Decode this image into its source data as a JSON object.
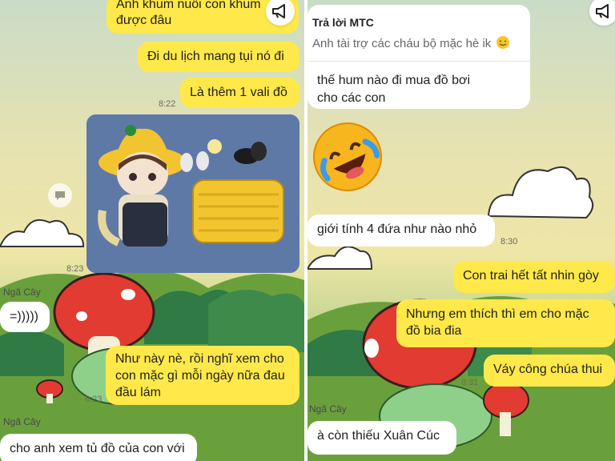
{
  "left": {
    "messages": {
      "m1": "Anh khum nuôi con khum",
      "m1b": "được đâu",
      "m2": "Đi du lịch mang tụi nó đi",
      "m3": "Là thêm 1 vali đồ",
      "m4a": "Như này nè, rồi nghĩ xem cho",
      "m4b": "con mặc gì mỗi ngày nữa đau",
      "m4c": "đầu lám",
      "t1": "=)))))",
      "t2": "cho anh xem tủ đồ của con với"
    },
    "times": {
      "a": "8:22",
      "b": "8:23",
      "c": "8:23"
    },
    "sender": "Ngã Cây",
    "sender2": "Ngã Cây"
  },
  "right": {
    "reply": {
      "header": "Trả lời MTC",
      "quote": "Anh tài trợ các cháu bộ mặc hè ik",
      "line1": "thế hum nào đi mua đồ bơi",
      "line2": "cho các con"
    },
    "messages": {
      "t1": "giới tính 4 đứa như nào nhỏ",
      "m1": "Con trai hết tất nhin gòy",
      "m2a": "Nhưng em thích thì em cho mặc",
      "m2b": "đồ bia đia",
      "m3": "Váy công chúa thui",
      "t2": "à còn thiếu Xuân Cúc"
    },
    "times": {
      "a": "8:30",
      "b": "8:31"
    },
    "sender": "Ngã Cây"
  },
  "icons": [
    "megaphone-icon",
    "comment-icon",
    "laughing-emoji",
    "smiling-emoji"
  ]
}
